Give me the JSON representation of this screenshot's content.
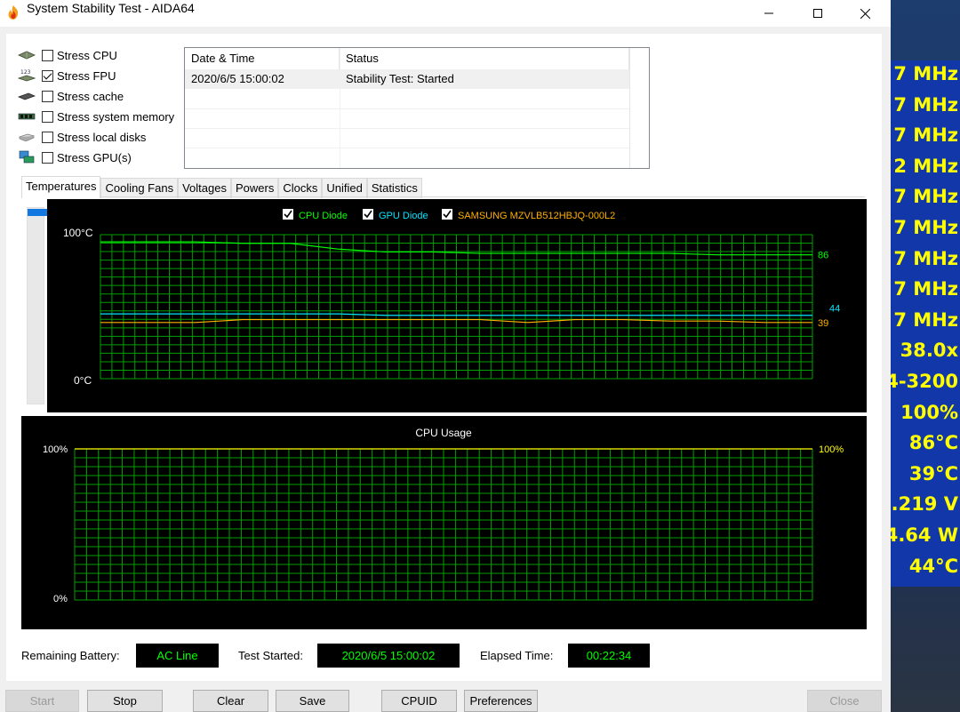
{
  "window": {
    "title": "System Stability Test - AIDA64",
    "minimize_glyph": "—",
    "maximize_glyph": "☐",
    "close_glyph": "✕"
  },
  "stress": [
    {
      "label": "Stress CPU",
      "checked": false,
      "icon": "cpu-icon"
    },
    {
      "label": "Stress FPU",
      "checked": true,
      "icon": "fpu-icon"
    },
    {
      "label": "Stress cache",
      "checked": false,
      "icon": "cache-icon"
    },
    {
      "label": "Stress system memory",
      "checked": false,
      "icon": "memory-icon"
    },
    {
      "label": "Stress local disks",
      "checked": false,
      "icon": "disk-icon"
    },
    {
      "label": "Stress GPU(s)",
      "checked": false,
      "icon": "gpu-icon"
    }
  ],
  "log": {
    "headers": [
      "Date & Time",
      "Status"
    ],
    "rows": [
      {
        "datetime": "2020/6/5 15:00:02",
        "status": "Stability Test: Started"
      }
    ]
  },
  "tabs": [
    "Temperatures",
    "Cooling Fans",
    "Voltages",
    "Powers",
    "Clocks",
    "Unified",
    "Statistics"
  ],
  "temp_chart": {
    "y_top_label": "100°C",
    "y_bottom_label": "0°C",
    "legend": [
      {
        "label": "CPU Diode",
        "color": "#00ff00",
        "checked": true
      },
      {
        "label": "GPU Diode",
        "color": "#00e5ff",
        "checked": true
      },
      {
        "label": "SAMSUNG MZVLB512HBJQ-000L2",
        "color": "#ffb000",
        "checked": true
      }
    ],
    "end_labels": [
      {
        "value": "86",
        "color": "#00ff00"
      },
      {
        "value": "44",
        "color": "#00e5ff"
      },
      {
        "value": "39",
        "color": "#ffb000"
      }
    ]
  },
  "cpu_chart": {
    "title": "CPU Usage",
    "y_top_label": "100%",
    "y_bottom_label": "0%",
    "end_label": "100%"
  },
  "chart_data": [
    {
      "type": "line",
      "ylim": [
        0,
        100
      ],
      "series": [
        {
          "name": "CPU Diode",
          "values": [
            95,
            95,
            95,
            94,
            94,
            90,
            88,
            88,
            87,
            87,
            87,
            87,
            87,
            86,
            86,
            86
          ]
        },
        {
          "name": "GPU Diode",
          "values": [
            45,
            45,
            45,
            45,
            45,
            45,
            44,
            44,
            44,
            44,
            44,
            44,
            44,
            44,
            44,
            44
          ]
        },
        {
          "name": "SAMSUNG MZVLB512HBJQ-000L2",
          "values": [
            39,
            39,
            39,
            41,
            41,
            41,
            41,
            41,
            41,
            39,
            41,
            41,
            40,
            40,
            39,
            39
          ]
        }
      ]
    },
    {
      "type": "line",
      "title": "CPU Usage",
      "ylim": [
        0,
        100
      ],
      "series": [
        {
          "name": "",
          "values": [
            100,
            100,
            100,
            100,
            100,
            100,
            100,
            100,
            100,
            100,
            100,
            100,
            100,
            100,
            100,
            100
          ]
        }
      ]
    }
  ],
  "status": {
    "battery_label": "Remaining Battery:",
    "battery_value": "AC Line",
    "started_label": "Test Started:",
    "started_value": "2020/6/5 15:00:02",
    "elapsed_label": "Elapsed Time:",
    "elapsed_value": "00:22:34"
  },
  "buttons": {
    "start": "Start",
    "stop": "Stop",
    "clear": "Clear",
    "save": "Save",
    "cpuid": "CPUID",
    "preferences": "Preferences",
    "close": "Close"
  },
  "osd": {
    "lines": [
      {
        "text": "7 MHz",
        "color": "#ffff00"
      },
      {
        "text": "7 MHz",
        "color": "#ffff00"
      },
      {
        "text": "7 MHz",
        "color": "#ffff00"
      },
      {
        "text": "2 MHz",
        "color": "#ffff00"
      },
      {
        "text": "7 MHz",
        "color": "#ffff00"
      },
      {
        "text": "7 MHz",
        "color": "#ffff00"
      },
      {
        "text": "7 MHz",
        "color": "#ffff00"
      },
      {
        "text": "7 MHz",
        "color": "#ffff00"
      },
      {
        "text": "7 MHz",
        "color": "#ffff00"
      },
      {
        "text": "38.0x",
        "color": "#ffff00"
      },
      {
        "text": "4-3200",
        "color": "#ffff00"
      },
      {
        "text": "100%",
        "color": "#ffff00"
      },
      {
        "text": "86°C",
        "color": "#ffff00"
      },
      {
        "text": "39°C",
        "color": "#ffff00"
      },
      {
        "text": ".219 V",
        "color": "#ffff00"
      },
      {
        "text": "4.64 W",
        "color": "#ffff00"
      },
      {
        "text": "44°C",
        "color": "#ffff00"
      }
    ]
  }
}
